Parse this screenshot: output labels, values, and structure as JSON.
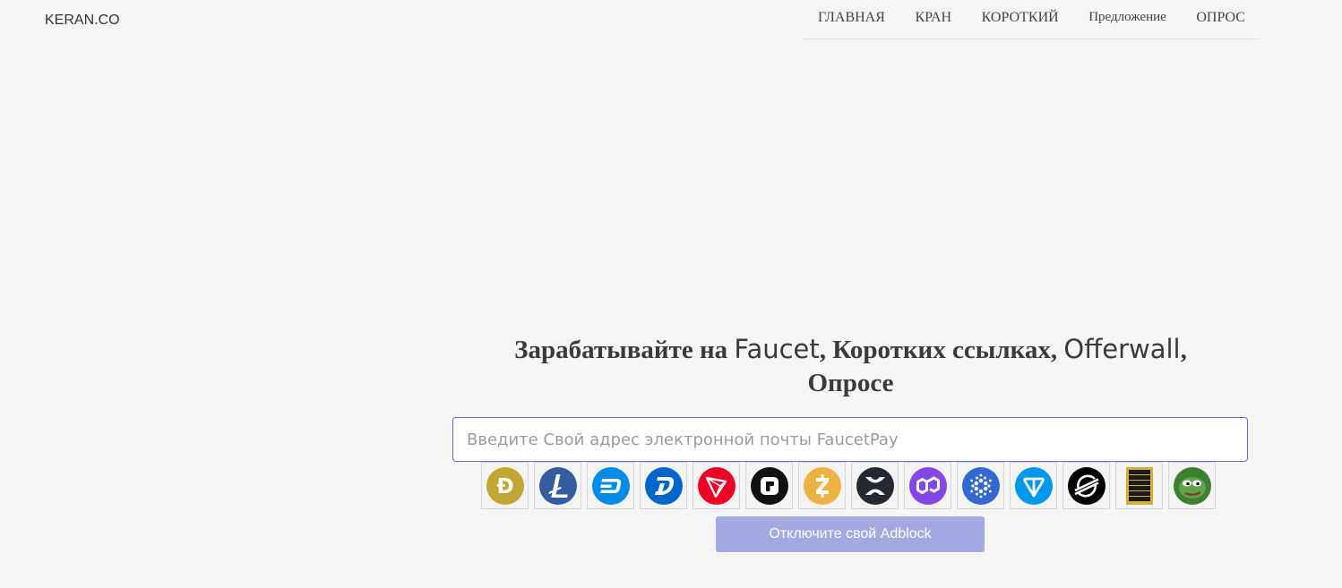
{
  "brand": "KERAN.CO",
  "nav": {
    "items": [
      {
        "label": "ГЛАВНАЯ"
      },
      {
        "label": "КРАН"
      },
      {
        "label": "КОРОТКИЙ"
      },
      {
        "label": "Предложение"
      },
      {
        "label": "ОПРОС"
      }
    ]
  },
  "hero": {
    "part1": "Зарабатывайте на ",
    "faucet": "Faucet",
    "part2": ", Коротких ссылках, ",
    "offerwall": "Offerwall",
    "part3": ",",
    "part4": "Опросе"
  },
  "email": {
    "placeholder": "Введите Свой адрес электронной почты FaucetPay",
    "value": ""
  },
  "coins": [
    {
      "name": "dogecoin",
      "icon": "dogecoin-icon",
      "color": "#c2a633"
    },
    {
      "name": "litecoin",
      "icon": "litecoin-icon",
      "color": "#345d9d"
    },
    {
      "name": "dash",
      "icon": "dash-icon",
      "color": "#008ce7"
    },
    {
      "name": "digibyte",
      "icon": "digibyte-icon",
      "color": "#0066cc"
    },
    {
      "name": "tron",
      "icon": "tron-icon",
      "color": "#ef0027"
    },
    {
      "name": "faucetpay",
      "icon": "faucetpay-icon",
      "color": "#111111"
    },
    {
      "name": "zcash",
      "icon": "zcash-icon",
      "color": "#ecb244"
    },
    {
      "name": "xrp",
      "icon": "xrp-icon",
      "color": "#23292f"
    },
    {
      "name": "polygon",
      "icon": "polygon-icon",
      "color": "#8247e5"
    },
    {
      "name": "cardano",
      "icon": "cardano-icon",
      "color": "#3468d1"
    },
    {
      "name": "toncoin",
      "icon": "toncoin-icon",
      "color": "#0098ea"
    },
    {
      "name": "stellar",
      "icon": "stellar-icon",
      "color": "#000000"
    },
    {
      "name": "meme-token",
      "icon": "meme-token-icon",
      "color": "#d4af37"
    },
    {
      "name": "pepe",
      "icon": "pepe-icon",
      "color": "#3d8130"
    }
  ],
  "cta": {
    "label": "Отключите свой Adblock"
  }
}
